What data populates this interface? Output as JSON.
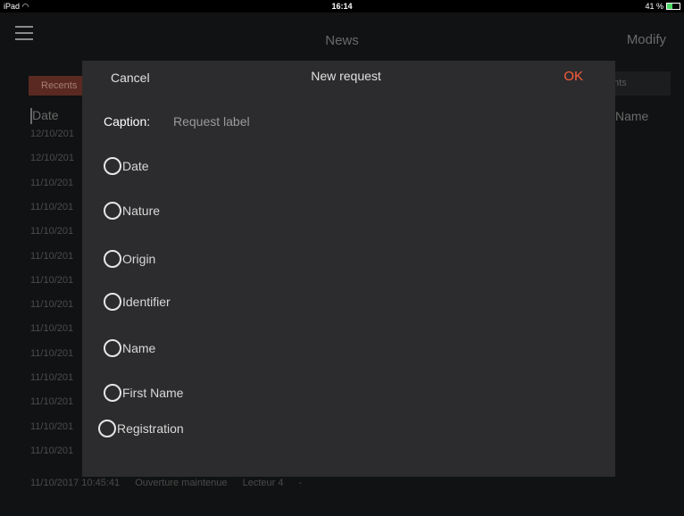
{
  "status_bar": {
    "device": "iPad",
    "time": "16:14",
    "battery": "41 %",
    "battery_level": 0.41
  },
  "nav": {
    "title": "News",
    "right_button": "Modify"
  },
  "tabs": {
    "recents": "Recents",
    "events_partial": "nts"
  },
  "columns": {
    "date": "Date",
    "name_partial": "Name"
  },
  "rows": [
    "12/10/201",
    "12/10/201",
    "11/10/201",
    "11/10/201",
    "11/10/201",
    "11/10/201",
    "11/10/201",
    "11/10/201",
    "11/10/201",
    "11/10/201",
    "11/10/201",
    "11/10/201",
    "11/10/201",
    "11/10/201"
  ],
  "last_row": {
    "datetime": "11/10/2017 10:45:41",
    "event": "Ouverture maintenue",
    "reader": "Lecteur 4",
    "name": "-"
  },
  "modal": {
    "cancel": "Cancel",
    "title": "New request",
    "ok": "OK",
    "caption_label": "Caption:",
    "caption_placeholder": "Request label",
    "caption_value": "",
    "options": [
      "Date",
      "Nature",
      "Origin",
      "Identifier",
      "Name",
      "First Name",
      "Registration"
    ]
  }
}
